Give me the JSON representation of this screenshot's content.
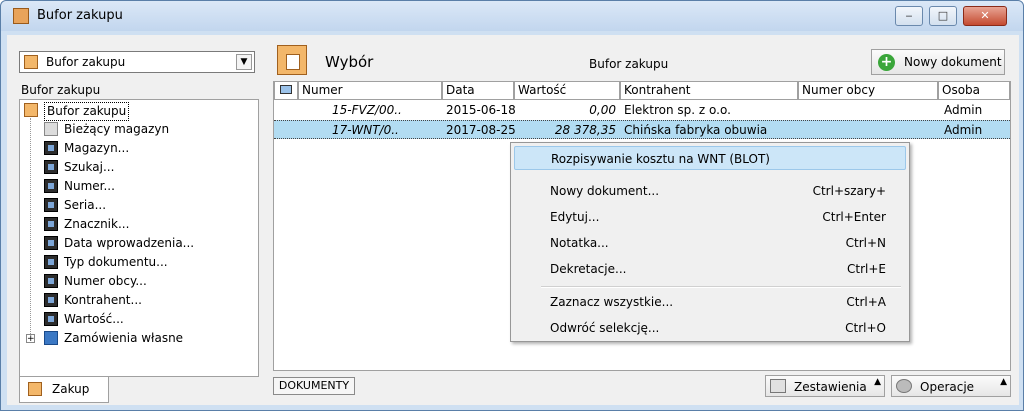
{
  "window": {
    "title": "Bufor zakupu",
    "minimize": "‒",
    "maximize": "□",
    "close": "✕"
  },
  "left": {
    "combo_value": "Bufor zakupu",
    "header": "Bufor zakupu",
    "tree": [
      {
        "label": "Bufor zakupu",
        "icon": "folder-icon"
      },
      {
        "label": "Bieżący magazyn",
        "icon": "warehouse-icon"
      },
      {
        "label": "Magazyn...",
        "icon": "binoculars-icon"
      },
      {
        "label": "Szukaj...",
        "icon": "binoculars-icon"
      },
      {
        "label": "Numer...",
        "icon": "binoculars-icon"
      },
      {
        "label": "Seria...",
        "icon": "binoculars-icon"
      },
      {
        "label": "Znacznik...",
        "icon": "binoculars-icon"
      },
      {
        "label": "Data wprowadzenia...",
        "icon": "binoculars-icon"
      },
      {
        "label": "Typ dokumentu...",
        "icon": "binoculars-icon"
      },
      {
        "label": "Numer obcy...",
        "icon": "binoculars-icon"
      },
      {
        "label": "Kontrahent...",
        "icon": "binoculars-icon"
      },
      {
        "label": "Wartość...",
        "icon": "binoculars-icon"
      },
      {
        "label": "Zamówienia własne",
        "icon": "document-icon",
        "expander": "+"
      }
    ],
    "tab_label": "Zakup"
  },
  "right": {
    "view_title": "Wybór",
    "center_title": "Bufor zakupu",
    "new_doc_label": "Nowy dokument",
    "columns": [
      "Numer",
      "Data",
      "Wartość",
      "Kontrahent",
      "Numer obcy",
      "Osoba"
    ],
    "rows": [
      {
        "numer": "15-FVZ/00..",
        "data": "2015-06-18",
        "wartosc": "0,00",
        "kontrahent": "Elektron sp. z o.o.",
        "numer_obcy": "",
        "osoba": "Admin"
      },
      {
        "numer": "17-WNT/0..",
        "data": "2017-08-25",
        "wartosc": "28 378,35",
        "kontrahent": "Chińska fabryka obuwia",
        "numer_obcy": "",
        "osoba": "Admin"
      }
    ],
    "dokumenty_label": "DOKUMENTY",
    "zestawienia_label": "Zestawienia",
    "operacje_label": "Operacje"
  },
  "context_menu": {
    "items": [
      {
        "label": "Rozpisywanie kosztu na WNT (BLOT)",
        "shortcut": ""
      },
      {
        "label": "Nowy dokument...",
        "shortcut": "Ctrl+szary+"
      },
      {
        "label": "Edytuj...",
        "shortcut": "Ctrl+Enter"
      },
      {
        "label": "Notatka...",
        "shortcut": "Ctrl+N"
      },
      {
        "label": "Dekretacje...",
        "shortcut": "Ctrl+E"
      },
      {
        "label": "Zaznacz wszystkie...",
        "shortcut": "Ctrl+A"
      },
      {
        "label": "Odwróć selekcję...",
        "shortcut": "Ctrl+O"
      }
    ]
  },
  "colors": {
    "selection_row": "#b2dcf2",
    "menu_highlight": "#cce6f8",
    "title_gradient_top": "#dbe8f7"
  }
}
